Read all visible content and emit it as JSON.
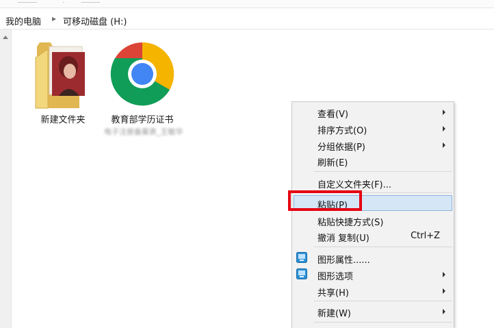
{
  "breadcrumb": {
    "items": [
      "我的电脑",
      "可移动磁盘 (H:)"
    ]
  },
  "desktop": {
    "items": [
      {
        "label": "新建文件夹",
        "icon": "folder-icon"
      },
      {
        "label": "教育部学历证书",
        "blurred_label": "电子注册备案表_王敏华",
        "icon": "chrome-icon"
      }
    ]
  },
  "context_menu": {
    "items": [
      {
        "label": "查看(V)",
        "submenu": true
      },
      {
        "label": "排序方式(O)",
        "submenu": true
      },
      {
        "label": "分组依据(P)",
        "submenu": true
      },
      {
        "label": "刷新(E)"
      },
      {
        "label": "自定义文件夹(F)..."
      },
      {
        "label": "粘贴(P)",
        "highlighted": true
      },
      {
        "label": "粘贴快捷方式(S)"
      },
      {
        "label": "撤消 复制(U)",
        "shortcut": "Ctrl+Z"
      },
      {
        "label": "图形属性......",
        "icon": "intel-graphics-icon"
      },
      {
        "label": "图形选项",
        "icon": "intel-graphics-icon",
        "submenu": true
      },
      {
        "label": "共享(H)",
        "submenu": true
      },
      {
        "label": "新建(W)",
        "submenu": true
      }
    ]
  },
  "colors": {
    "highlight_bg": "#d5e6f7",
    "highlight_border": "#8cb4dd",
    "annotation_red": "#e60012"
  }
}
